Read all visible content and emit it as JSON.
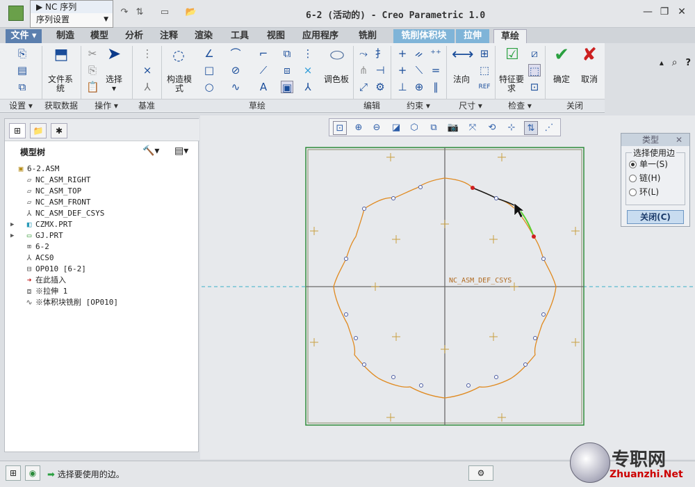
{
  "window": {
    "title": "6-2 (活动的) - Creo Parametric 1.0"
  },
  "dropdown": {
    "items": [
      "NC 序列",
      "序列设置"
    ]
  },
  "tabs": [
    {
      "label": "文件"
    },
    {
      "label": "制造"
    },
    {
      "label": "模型"
    },
    {
      "label": "分析"
    },
    {
      "label": "注释"
    },
    {
      "label": "渲染"
    },
    {
      "label": "工具"
    },
    {
      "label": "视图"
    },
    {
      "label": "应用程序"
    },
    {
      "label": "铣削"
    },
    {
      "label": "铣削体积块"
    },
    {
      "label": "拉伸"
    },
    {
      "label": "草绘"
    }
  ],
  "ribbon": {
    "groups": [
      "设置",
      "获取数据",
      "操作",
      "基准",
      "草绘",
      "编辑",
      "约束",
      "尺寸",
      "检查",
      "关闭"
    ],
    "file_system": "文件系统",
    "select": "选择",
    "construct_mode": "构造模式",
    "palette": "调色板",
    "normal": "法向",
    "feature_req": "特征要求",
    "ok": "确定",
    "cancel": "取消"
  },
  "panel": {
    "title": "模型树",
    "tree": [
      {
        "label": "6-2.ASM",
        "icon": "assembly-icon",
        "toggle": ""
      },
      {
        "label": "NC_ASM_RIGHT",
        "icon": "datum-plane-icon",
        "toggle": ""
      },
      {
        "label": "NC_ASM_TOP",
        "icon": "datum-plane-icon",
        "toggle": ""
      },
      {
        "label": "NC_ASM_FRONT",
        "icon": "datum-plane-icon",
        "toggle": ""
      },
      {
        "label": "NC_ASM_DEF_CSYS",
        "icon": "csys-icon",
        "toggle": ""
      },
      {
        "label": "CZMX.PRT",
        "icon": "part-icon",
        "toggle": "▶"
      },
      {
        "label": "GJ.PRT",
        "icon": "workpiece-icon",
        "toggle": "▶"
      },
      {
        "label": "6-2",
        "icon": "workcell-icon",
        "toggle": ""
      },
      {
        "label": "ACS0",
        "icon": "csys-icon",
        "toggle": ""
      },
      {
        "label": "OP010 [6-2]",
        "icon": "operation-icon",
        "toggle": ""
      },
      {
        "label": "在此插入",
        "icon": "insert-arrow-icon",
        "toggle": ""
      },
      {
        "label": "※拉伸 1",
        "icon": "extrude-icon",
        "toggle": ""
      },
      {
        "label": "※体积块铣削 [OP010]",
        "icon": "volume-mill-icon",
        "toggle": ""
      }
    ]
  },
  "canvas": {
    "csys_label": "NC_ASM_DEF_CSYS"
  },
  "dialog": {
    "title": "类型",
    "group": "选择使用边",
    "options": [
      "单一(S)",
      "链(H)",
      "环(L)"
    ],
    "selected": 0,
    "close": "关闭(C)"
  },
  "status": {
    "message": "选择要使用的边。"
  },
  "watermark": {
    "text": "专职网",
    "url": "Zhuanzhi.Net"
  },
  "colors": {
    "accent": "#1a4d9a",
    "curve": "#e08a20",
    "selected": "#1a1a1a",
    "highlight": "#5ad030",
    "frame": "#2f8a3a",
    "axis": "#6a6a6a",
    "construction_h": "#3ab0c8"
  }
}
